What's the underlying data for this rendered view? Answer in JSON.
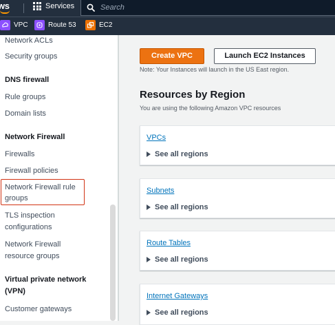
{
  "topnav": {
    "logo_text": "aws",
    "services_label": "Services",
    "search_placeholder": "Search"
  },
  "favorites": [
    {
      "label": "VPC",
      "icon": "vpc-icon",
      "color": "#8c4fff"
    },
    {
      "label": "Route 53",
      "icon": "route53-icon",
      "color": "#8c4fff"
    },
    {
      "label": "EC2",
      "icon": "ec2-icon",
      "color": "#ed7100"
    }
  ],
  "sidebar": {
    "items": [
      {
        "label": "Network ACLs"
      },
      {
        "label": "Security groups"
      },
      {
        "label": "DNS firewall",
        "heading": true
      },
      {
        "label": "Rule groups"
      },
      {
        "label": "Domain lists"
      },
      {
        "label": "Network Firewall",
        "heading": true
      },
      {
        "label": "Firewalls"
      },
      {
        "label": "Firewall policies"
      },
      {
        "label": "Network Firewall rule groups",
        "highlighted": true
      },
      {
        "label": "TLS inspection configurations"
      },
      {
        "label": "Network Firewall resource groups"
      },
      {
        "label": "Virtual private network (VPN)",
        "heading": true
      },
      {
        "label": "Customer gateways"
      }
    ]
  },
  "main": {
    "create_vpc_label": "Create VPC",
    "launch_ec2_label": "Launch EC2 Instances",
    "note": "Note: Your Instances will launch in the US East region.",
    "resources_title": "Resources by Region",
    "resources_subtitle": "You are using the following Amazon VPC resources",
    "cards": [
      {
        "title": "VPCs",
        "expand_label": "See all regions"
      },
      {
        "title": "Subnets",
        "expand_label": "See all regions"
      },
      {
        "title": "Route Tables",
        "expand_label": "See all regions"
      },
      {
        "title": "Internet Gateways",
        "expand_label": "See all regions"
      }
    ]
  },
  "colors": {
    "nav_bg": "#232f3e",
    "primary_button": "#ec7211",
    "link": "#0073bb",
    "highlight_border": "#d13212"
  }
}
